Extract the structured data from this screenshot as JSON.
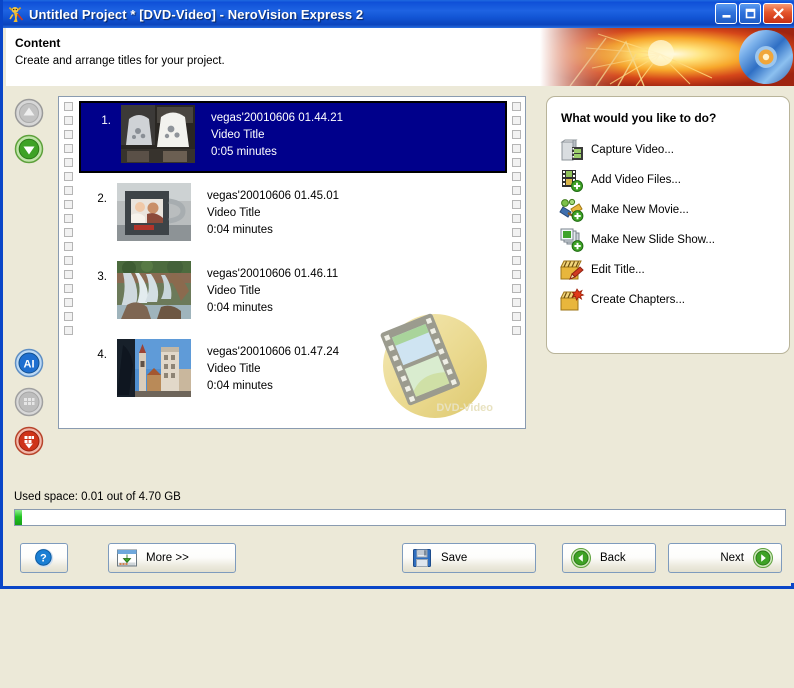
{
  "window": {
    "title": "Untitled Project * [DVD-Video] - NeroVision Express 2",
    "app_icon": "nero-lion-icon",
    "buttons": {
      "minimize": "minimize-button",
      "maximize": "maximize-button",
      "close": "close-button"
    }
  },
  "header": {
    "title": "Content",
    "subtitle": "Create and arrange titles for your project."
  },
  "rail": {
    "move_up": "move-up-arrow",
    "move_down": "move-down-arrow",
    "tool_blue": "properties-button",
    "tool_gray": "delete-button-disabled",
    "tool_red": "remove-button"
  },
  "content_list": {
    "watermark_label": "DVD-Video",
    "items": [
      {
        "number": "1.",
        "name": "vegas'20010606 01.44.21",
        "type": "Video Title",
        "duration": "0:05 minutes",
        "selected": true,
        "thumb": "tshirt-display"
      },
      {
        "number": "2.",
        "name": "vegas'20010606 01.45.01",
        "type": "Video Title",
        "duration": "0:04 minutes",
        "selected": false,
        "thumb": "coffee-mug"
      },
      {
        "number": "3.",
        "name": "vegas'20010606 01.46.11",
        "type": "Video Title",
        "duration": "0:04 minutes",
        "selected": false,
        "thumb": "waterfall"
      },
      {
        "number": "4.",
        "name": "vegas'20010606 01.47.24",
        "type": "Video Title",
        "duration": "0:04 minutes",
        "selected": false,
        "thumb": "city-buildings"
      }
    ]
  },
  "task_panel": {
    "heading": "What would you like to do?",
    "tasks": [
      {
        "label": "Capture Video...",
        "icon": "capture-video-icon"
      },
      {
        "label": "Add Video Files...",
        "icon": "add-video-files-icon"
      },
      {
        "label": "Make New Movie...",
        "icon": "make-new-movie-icon"
      },
      {
        "label": "Make New Slide Show...",
        "icon": "make-new-slide-show-icon"
      },
      {
        "label": "Edit Title...",
        "icon": "edit-title-icon"
      },
      {
        "label": "Create Chapters...",
        "icon": "create-chapters-icon"
      }
    ]
  },
  "status": {
    "used_space": "Used space: 0.01 out of 4.70 GB",
    "progress_percent": 0.6
  },
  "footer": {
    "help": "?",
    "more": "More >>",
    "save": "Save",
    "back": "Back",
    "next": "Next"
  },
  "colors": {
    "titlebar_blue": "#0f50d8",
    "selection_navy": "#00008b",
    "face": "#ece9d8",
    "progress_green": "#22c322",
    "accent_green": "#2da02d"
  }
}
